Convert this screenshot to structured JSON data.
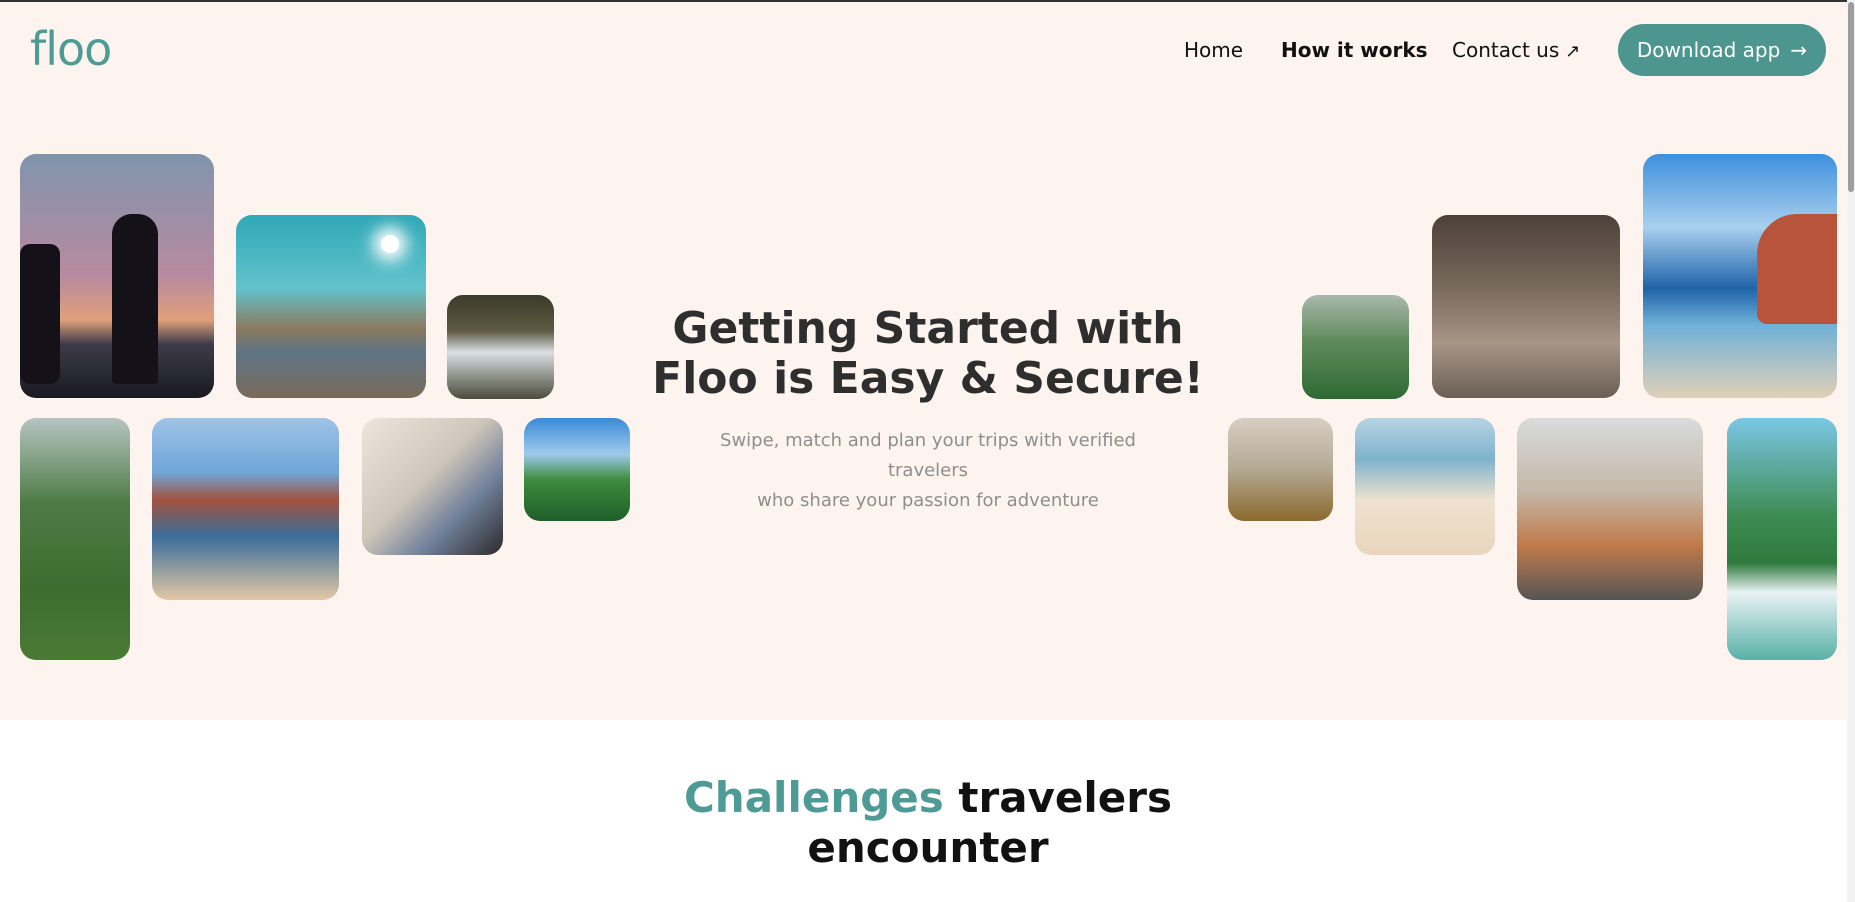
{
  "header": {
    "logo": "floo",
    "nav": {
      "home": "Home",
      "how_it_works": "How it works",
      "contact": "Contact us",
      "contact_icon": "arrow-up-right-icon"
    },
    "download_button": "Download app",
    "download_icon": "arrow-right-icon"
  },
  "hero": {
    "title": "Getting Started with Floo is Easy & Secure!",
    "subtitle_line1": "Swipe, match and plan your trips with verified travelers",
    "subtitle_line2": "who share your passion for adventure"
  },
  "challenges": {
    "accent": "Challenges",
    "rest": "travelers encounter"
  },
  "colors": {
    "accent": "#4e9a95",
    "button": "#4d958f",
    "hero_bg": "#fdf4f0"
  }
}
